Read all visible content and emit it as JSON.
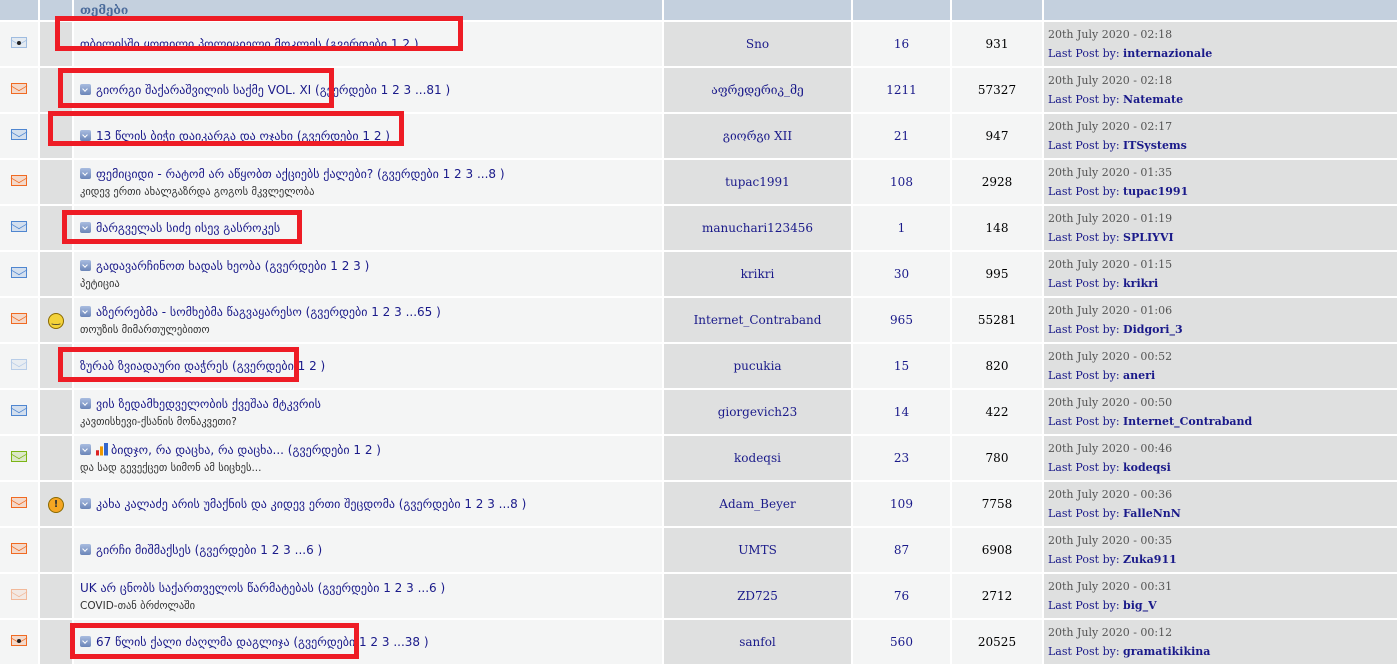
{
  "header": {
    "topics_label": "თემები"
  },
  "colors": {
    "orange": "#f06a22",
    "blue": "#4f86d0",
    "pale_blue": "#b8cde8",
    "green": "#7bb515",
    "pale_orange": "#f2b99a",
    "highlight": "#ee1c25"
  },
  "rows": [
    {
      "icon": "mail-read-hot-icon",
      "color": "#9fbce0",
      "dot": true,
      "emoji": "",
      "mini": false,
      "title": "თბილისში ყოფილი პოლიციელი მოკლეს (გვერდები 1 2 )",
      "subtitle": "",
      "starter": "Sno",
      "replies": "16",
      "views": "931",
      "date": "20th July 2020 - 02:18",
      "last_by_label": "Last Post by:",
      "last_by": "internazionale"
    },
    {
      "icon": "mail-orange-icon",
      "color": "#f06a22",
      "emoji": "",
      "mini": true,
      "title": "გიორგი შაქარაშვილის საქმე VOL. XI (გვერდები 1 2 3 ...81 )",
      "subtitle": "",
      "starter": "აფრედერიკ_მე",
      "replies": "1211",
      "views": "57327",
      "date": "20th July 2020 - 02:18",
      "last_by_label": "Last Post by:",
      "last_by": "Natemate"
    },
    {
      "icon": "mail-blue-icon",
      "color": "#4f86d0",
      "emoji": "",
      "mini": true,
      "title": "13 წლის ბიჭი დაიკარგა და ოჯახი (გვერდები 1 2 )",
      "subtitle": "",
      "starter": "გიორგი XII",
      "replies": "21",
      "views": "947",
      "date": "20th July 2020 - 02:17",
      "last_by_label": "Last Post by:",
      "last_by": "ITSystems"
    },
    {
      "icon": "mail-orange-icon",
      "color": "#f06a22",
      "emoji": "",
      "mini": true,
      "title": "ფემიციდი - რატომ არ აწყობთ აქციებს ქალები? (გვერდები 1 2 3 ...8 )",
      "subtitle": "კიდევ ერთი ახალგაზრდა გოგოს მკვლელობა",
      "starter": "tupac1991",
      "replies": "108",
      "views": "2928",
      "date": "20th July 2020 - 01:35",
      "last_by_label": "Last Post by:",
      "last_by": "tupac1991"
    },
    {
      "icon": "mail-blue-icon",
      "color": "#4f86d0",
      "emoji": "",
      "mini": true,
      "title": "მარგველას სიძე ისევ გასროკეს",
      "subtitle": "",
      "starter": "manuchari123456",
      "replies": "1",
      "views": "148",
      "date": "20th July 2020 - 01:19",
      "last_by_label": "Last Post by:",
      "last_by": "SPLIYVI"
    },
    {
      "icon": "mail-blue-icon",
      "color": "#4f86d0",
      "emoji": "",
      "mini": true,
      "title": "გადავარჩინოთ ხადას ხეობა (გვერდები 1 2 3 )",
      "subtitle": "პეტიცია",
      "starter": "krikri",
      "replies": "30",
      "views": "995",
      "date": "20th July 2020 - 01:15",
      "last_by_label": "Last Post by:",
      "last_by": "krikri"
    },
    {
      "icon": "mail-orange-icon",
      "color": "#f06a22",
      "emoji": "smiley",
      "mini": true,
      "title": "აზერრებმა - სომხებმა წაგვაყარესო (გვერდები 1 2 3 ...65 )",
      "subtitle": "თოუზის მიმართულებითო",
      "starter": "Internet_Contraband",
      "replies": "965",
      "views": "55281",
      "date": "20th July 2020 - 01:06",
      "last_by_label": "Last Post by:",
      "last_by": "Didgori_3"
    },
    {
      "icon": "mail-pale-blue-icon",
      "color": "#b8cde8",
      "emoji": "",
      "mini": false,
      "title": "ზურაბ ზვიადაური დაჭრეს (გვერდები 1 2 )",
      "subtitle": "",
      "starter": "pucukia",
      "replies": "15",
      "views": "820",
      "date": "20th July 2020 - 00:52",
      "last_by_label": "Last Post by:",
      "last_by": "aneri"
    },
    {
      "icon": "mail-blue-icon",
      "color": "#4f86d0",
      "emoji": "",
      "mini": true,
      "title": "ვის ზედამხედველობის ქვეშაა მტკვრის",
      "subtitle": "კავთისხევი-ქსანის მონაკვეთი?",
      "starter": "giorgevich23",
      "replies": "14",
      "views": "422",
      "date": "20th July 2020 - 00:50",
      "last_by_label": "Last Post by:",
      "last_by": "Internet_Contraband"
    },
    {
      "icon": "mail-green-icon",
      "color": "#7bb515",
      "emoji": "",
      "mini": true,
      "poll": true,
      "title": "ბიდჯო, რა დაცხა, რა დაცხა... (გვერდები 1 2 )",
      "subtitle": "და სად გევექცეთ სიმონ ამ სიცხეს...",
      "starter": "kodeqsi",
      "replies": "23",
      "views": "780",
      "date": "20th July 2020 - 00:46",
      "last_by_label": "Last Post by:",
      "last_by": "kodeqsi"
    },
    {
      "icon": "mail-orange-icon",
      "color": "#f06a22",
      "emoji": "warning",
      "mini": true,
      "title": "კახა კალაძე არის უმაქნის და კიდევ ერთი შეცდომა (გვერდები 1 2 3 ...8 )",
      "subtitle": "",
      "starter": "Adam_Beyer",
      "replies": "109",
      "views": "7758",
      "date": "20th July 2020 - 00:36",
      "last_by_label": "Last Post by:",
      "last_by": "FalleNnN"
    },
    {
      "icon": "mail-orange-icon",
      "color": "#f06a22",
      "emoji": "",
      "mini": true,
      "title": "გირჩი მიშმაქსეს (გვერდები 1 2 3 ...6 )",
      "subtitle": "",
      "starter": "UMTS",
      "replies": "87",
      "views": "6908",
      "date": "20th July 2020 - 00:35",
      "last_by_label": "Last Post by:",
      "last_by": "Zuka911"
    },
    {
      "icon": "mail-pale-orange-icon",
      "color": "#f2b99a",
      "emoji": "",
      "mini": false,
      "title": "UK არ ცნობს საქართველოს წარმატებას (გვერდები 1 2 3 ...6 )",
      "subtitle": "COVID-თან ბრძოლაში",
      "starter": "ZD725",
      "replies": "76",
      "views": "2712",
      "date": "20th July 2020 - 00:31",
      "last_by_label": "Last Post by:",
      "last_by": "big_V"
    },
    {
      "icon": "mail-orange-hot-icon",
      "color": "#f06a22",
      "dot": true,
      "emoji": "",
      "mini": true,
      "title": "67 წლის ქალი ძაღლმა დაგლიჯა (გვერდები 1 2 3 ...38 )",
      "subtitle": "",
      "starter": "sanfol",
      "replies": "560",
      "views": "20525",
      "date": "20th July 2020 - 00:12",
      "last_by_label": "Last Post by:",
      "last_by": "gramatikikina"
    }
  ]
}
